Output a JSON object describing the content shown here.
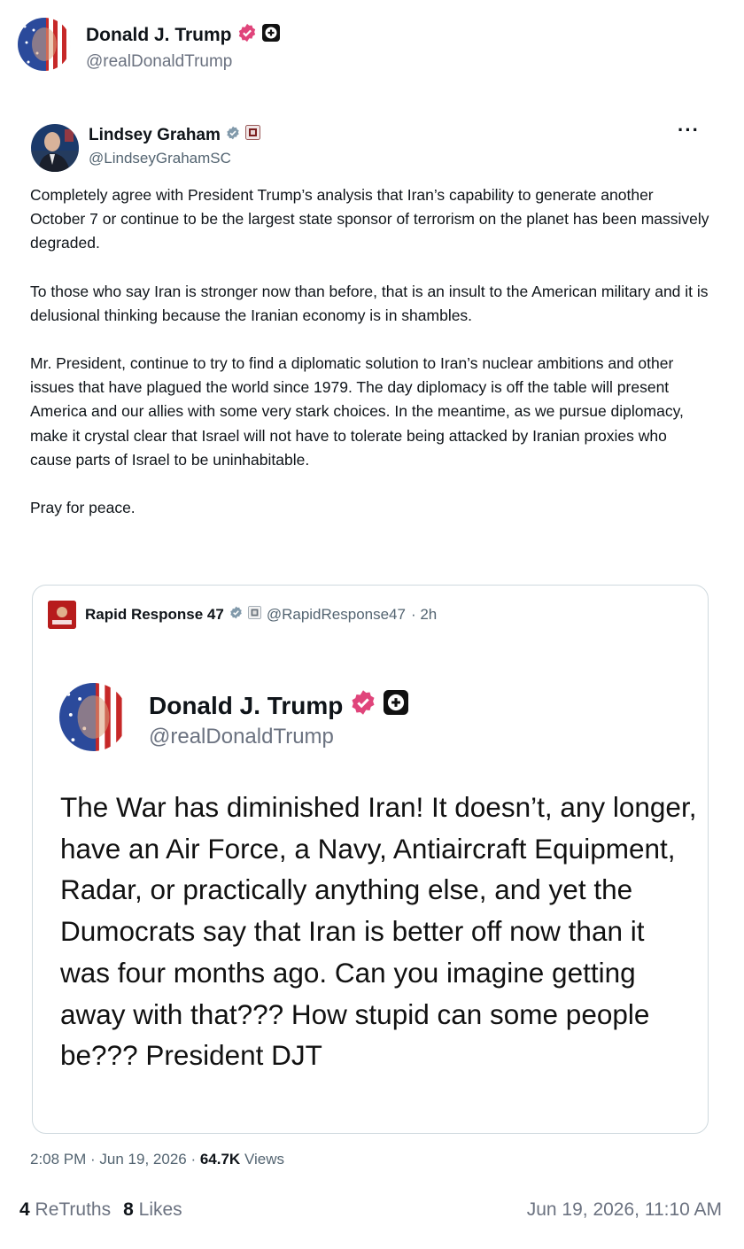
{
  "outer_post": {
    "author_name": "Donald J. Trump",
    "author_handle": "@realDonaldTrump",
    "retruths_count": "4",
    "retruths_label": "ReTruths",
    "likes_count": "8",
    "likes_label": "Likes",
    "posted_at": "Jun 19, 2026, 11:10 AM"
  },
  "tweet": {
    "author_name": "Lindsey Graham",
    "author_handle": "@LindseyGrahamSC",
    "more_label": "···",
    "paragraphs": [
      "Completely agree with President Trump’s analysis that Iran’s capability to generate another October 7 or continue to be the largest state sponsor of terrorism on the planet has been massively degraded.",
      "To those who say Iran is stronger now than before, that is an insult to the American military and it is delusional thinking because the Iranian economy is in shambles.",
      "Mr. President, continue to try to find a diplomatic solution to Iran’s nuclear ambitions and other issues that have plagued the world since 1979. The day diplomacy is off the table will present America and our allies with some very stark choices. In the meantime, as we pursue diplomacy, make it crystal clear that Israel will not have to tolerate being attacked by Iranian proxies who cause parts of Israel to be uninhabitable.",
      "Pray for peace."
    ],
    "time": "2:08 PM · Jun 19, 2026 ·",
    "views_count": "64.7K",
    "views_label": "Views"
  },
  "quote": {
    "account_name": "Rapid Response 47",
    "account_handle": "@RapidResponse47",
    "age": "· 2h",
    "embedded_author_name": "Donald J. Trump",
    "embedded_author_handle": "@realDonaldTrump",
    "embedded_text": "The War has diminished Iran! It doesn’t, any longer, have an Air Force, a Navy, Antiaircraft Equipment, Radar, or practically anything else, and yet the Dumocrats say that Iran is better off now than it was four months ago. Can you imagine getting away with that??? How stupid can some people be??? President DJT"
  },
  "icons": {
    "verified_truth": "verified-badge-icon",
    "plus_badge": "plus-badge-icon",
    "verified_x": "gray-verified-icon",
    "gov_badge": "government-badge-icon"
  },
  "colors": {
    "verified_pink": "#e0457b",
    "gray_text": "#536471",
    "border": "#cfd9de"
  }
}
